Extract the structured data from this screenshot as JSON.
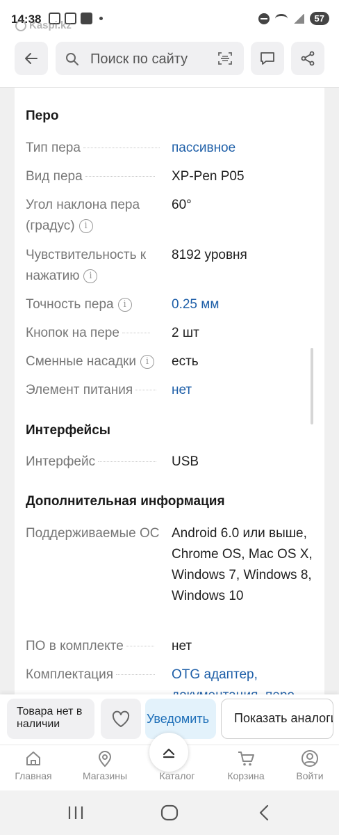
{
  "status_bar": {
    "time": "14:38",
    "battery": "57",
    "watermark": "Kaspi.kz"
  },
  "header": {
    "search_placeholder": "Поиск по сайту"
  },
  "sections": {
    "pen": {
      "title": "Перо",
      "rows": [
        {
          "label": "Тип пера",
          "value": "пассивное"
        },
        {
          "label": "Вид пера",
          "value": "XP-Pen P05"
        },
        {
          "label": "Угол наклона пера (градус)",
          "value": "60°"
        },
        {
          "label": "Чувствительность к нажатию",
          "value": "8192 уровня"
        },
        {
          "label": "Точность пера",
          "value": "0.25 мм"
        },
        {
          "label": "Кнопок на пере",
          "value": "2 шт"
        },
        {
          "label": "Сменные насадки",
          "value": "есть"
        },
        {
          "label": "Элемент питания",
          "value": "нет"
        }
      ]
    },
    "interfaces": {
      "title": "Интерфейсы",
      "rows": [
        {
          "label": "Интерфейс",
          "value": "USB"
        }
      ]
    },
    "extra": {
      "title": "Дополнительная информация",
      "rows": [
        {
          "label": "Поддерживаемые ОС",
          "value": "Android 6.0 или выше, Chrome OS, Mac OS X, Windows 7, Windows 8, Windows 10"
        },
        {
          "label": "ПО в комплекте",
          "value": "нет"
        },
        {
          "label": "Комплектация",
          "value": "OTG адаптер, документация, перо"
        }
      ]
    }
  },
  "action_bar": {
    "stock_text": "Товара нет в наличии",
    "notify_label": "Уведомить",
    "show_label": "Показать аналоги"
  },
  "nav": {
    "items": [
      {
        "label": "Главная"
      },
      {
        "label": "Магазины"
      },
      {
        "label": "Каталог"
      },
      {
        "label": "Корзина"
      },
      {
        "label": "Войти"
      }
    ]
  },
  "colors": {
    "link": "#1e5fa8",
    "notify_text": "#1e6fb8",
    "notify_bg": "#e3f2fb"
  }
}
